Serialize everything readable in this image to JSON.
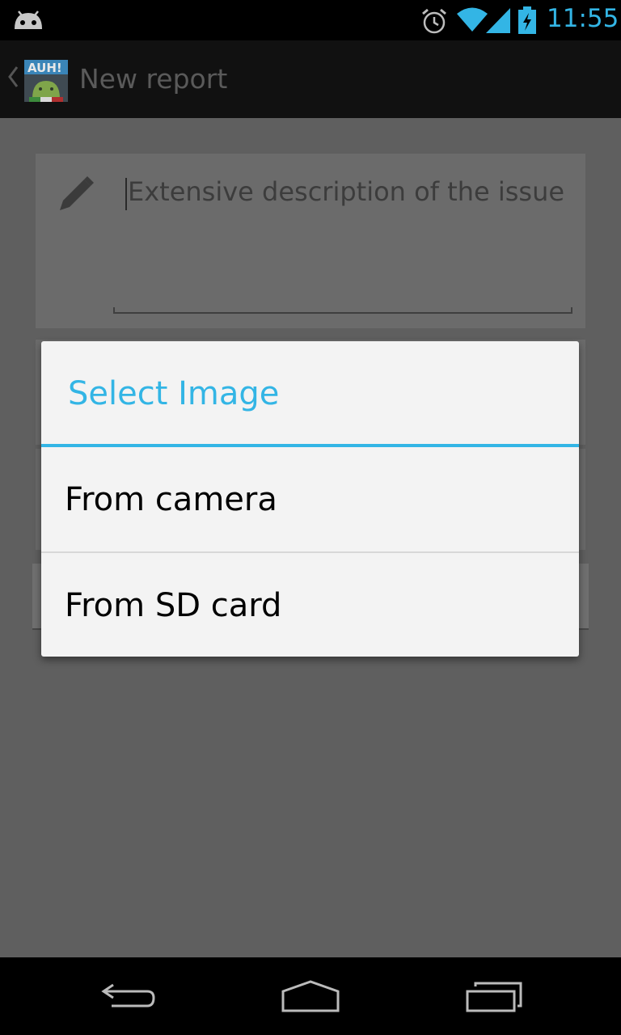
{
  "status_bar": {
    "time": "11:55",
    "icons": [
      "android-icon",
      "alarm-icon",
      "wifi-icon",
      "signal-icon",
      "battery-charging-icon"
    ],
    "accent": "#33b5e5"
  },
  "action_bar": {
    "title": "New report",
    "app_icon_text": "AUH!",
    "icons": [
      "up-caret-icon",
      "app-icon"
    ]
  },
  "form": {
    "description_placeholder": "Extensive description of the issue",
    "icon": "pencil-icon"
  },
  "dialog": {
    "title": "Select Image",
    "options": [
      {
        "label": "From camera"
      },
      {
        "label": "From SD card"
      }
    ],
    "accent": "#33b5e5"
  },
  "nav_bar": {
    "icons": [
      "back-icon",
      "home-icon",
      "recents-icon"
    ]
  }
}
